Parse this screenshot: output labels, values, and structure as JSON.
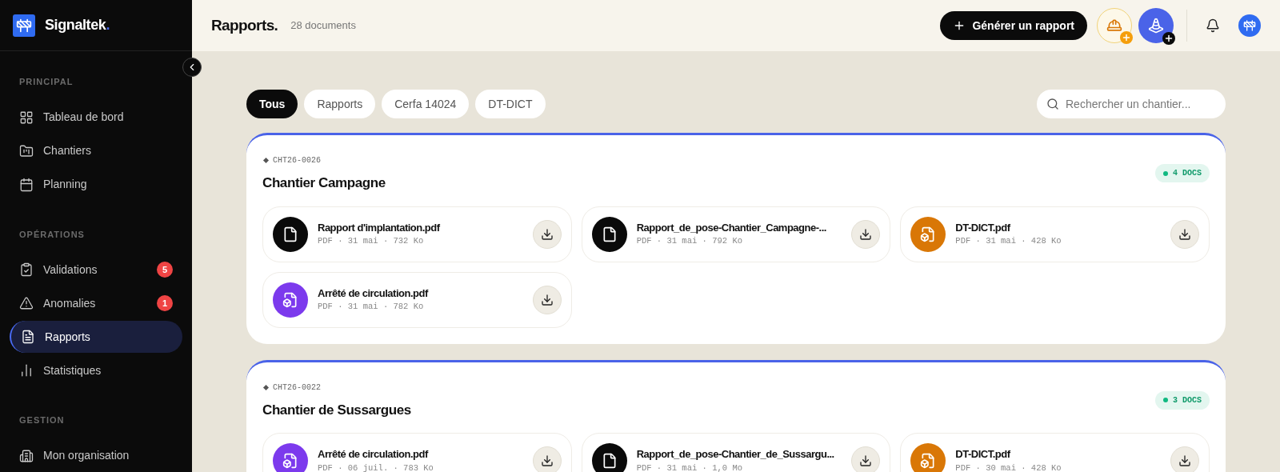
{
  "brand": {
    "name": "Signaltek",
    "dot": "."
  },
  "sidebar": {
    "sections": [
      {
        "title": "PRINCIPAL",
        "items": [
          {
            "label": "Tableau de bord",
            "kind": "dashboard",
            "selected": false
          },
          {
            "label": "Chantiers",
            "kind": "folder",
            "selected": false
          },
          {
            "label": "Planning",
            "kind": "calendar",
            "selected": false
          }
        ]
      },
      {
        "title": "OPÉRATIONS",
        "items": [
          {
            "label": "Validations",
            "kind": "clipboard",
            "selected": false,
            "badge": "5"
          },
          {
            "label": "Anomalies",
            "kind": "alert",
            "selected": false,
            "badge": "1"
          },
          {
            "label": "Rapports",
            "kind": "report",
            "selected": true
          },
          {
            "label": "Statistiques",
            "kind": "chart",
            "selected": false
          }
        ]
      },
      {
        "title": "GESTION",
        "items": [
          {
            "label": "Mon organisation",
            "kind": "building",
            "selected": false
          }
        ]
      }
    ]
  },
  "header": {
    "title": "Rapports.",
    "count": "28 documents",
    "action": "Générer un rapport"
  },
  "filters": [
    {
      "label": "Tous",
      "selected": true
    },
    {
      "label": "Rapports",
      "selected": false
    },
    {
      "label": "Cerfa 14024",
      "selected": false
    },
    {
      "label": "DT-DICT",
      "selected": false
    }
  ],
  "search": {
    "placeholder": "Rechercher un chantier..."
  },
  "sites": [
    {
      "code": "CHT26-0026",
      "name": "Chantier Campagne",
      "docs_badge": "4 DOCS",
      "files": [
        {
          "name": "Rapport d'implantation.pdf",
          "meta": "PDF · 31 mai · 732 Ko",
          "kind": "report",
          "color": "#0a0a0a"
        },
        {
          "name": "Rapport_de_pose-Chantier_Campagne-...",
          "meta": "PDF · 31 mai · 792 Ko",
          "kind": "report",
          "color": "#0a0a0a"
        },
        {
          "name": "DT-DICT.pdf",
          "meta": "PDF · 31 mai · 428 Ko",
          "kind": "permit",
          "color": "#d97706"
        },
        {
          "name": "Arrêté de circulation.pdf",
          "meta": "PDF · 31 mai · 782 Ko",
          "kind": "permit",
          "color": "#7c3aed"
        }
      ]
    },
    {
      "code": "CHT26-0022",
      "name": "Chantier de Sussargues",
      "docs_badge": "3 DOCS",
      "files": [
        {
          "name": "Arrêté de circulation.pdf",
          "meta": "PDF · 06 juil. · 783 Ko",
          "kind": "permit",
          "color": "#7c3aed"
        },
        {
          "name": "Rapport_de_pose-Chantier_de_Sussargu...",
          "meta": "PDF · 31 mai · 1,0 Mo",
          "kind": "report",
          "color": "#0a0a0a"
        },
        {
          "name": "DT-DICT.pdf",
          "meta": "PDF · 30 mai · 428 Ko",
          "kind": "permit",
          "color": "#d97706"
        }
      ]
    }
  ]
}
